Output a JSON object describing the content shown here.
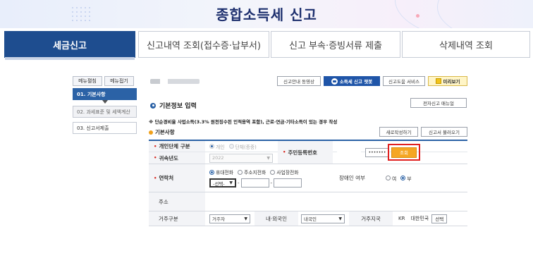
{
  "banner": {
    "title": "종합소득세 신고"
  },
  "tabs": [
    {
      "label": "세금신고"
    },
    {
      "label": "신고내역 조회(접수증·납부서)"
    },
    {
      "label": "신고 부속·증빙서류 제출"
    },
    {
      "label": "삭제내역 조회"
    }
  ],
  "sidemenu": {
    "expand_label": "메뉴펼침",
    "collapse_label": "메뉴접기",
    "items": [
      {
        "label": "01. 기본사항"
      },
      {
        "label": "02. 과세표준 및 세액계산"
      },
      {
        "label": "03. 신고서제출"
      }
    ]
  },
  "toolbar": {
    "guide_video": "신고안내 동영상",
    "chatbot": "소득세 신고 챗봇",
    "help_service": "신고도움 서비스",
    "preview": "미리보기"
  },
  "section": {
    "title": "기본정보 입력",
    "manual_button": "전자신고 매뉴얼",
    "notice": "※ 단순경비율 사업소득(3.3% 원천징수된 인적용역 포함), 근로·연금·기타소득이 있는 경우 작성",
    "subtitle": "기본사항",
    "rewrite_button": "새로작성하기",
    "load_button": "신고서 불러오기"
  },
  "form": {
    "entity_type": {
      "label": "개인단체 구분",
      "options": [
        "개인",
        "단체(종중)"
      ],
      "selected": "개인"
    },
    "tax_year": {
      "label": "귀속년도",
      "value": "2022"
    },
    "resident_no": {
      "label": "주민등록번호",
      "masked": "•••••••",
      "lookup_button": "조회"
    },
    "contact": {
      "label": "연락처",
      "options": [
        "휴대전화",
        "주소지전화",
        "사업장전화"
      ],
      "selected": "휴대전화",
      "prefix_select": "-선택-",
      "dash1": "-",
      "dash2": "-"
    },
    "disability": {
      "label": "장애인 여부",
      "options": [
        "여",
        "부"
      ],
      "selected": "부"
    },
    "address": {
      "label": "주소"
    },
    "residence_type": {
      "label": "거주구분",
      "value": "거주자"
    },
    "nationality": {
      "label": "내·외국인",
      "value": "내국인"
    },
    "residence_country": {
      "label": "거주지국",
      "code": "KR",
      "name": "대한민국",
      "select_button": "선택"
    }
  },
  "colors": {
    "primary": "#1e4d8f",
    "highlight": "#e02020",
    "lookup": "#f5a623"
  }
}
